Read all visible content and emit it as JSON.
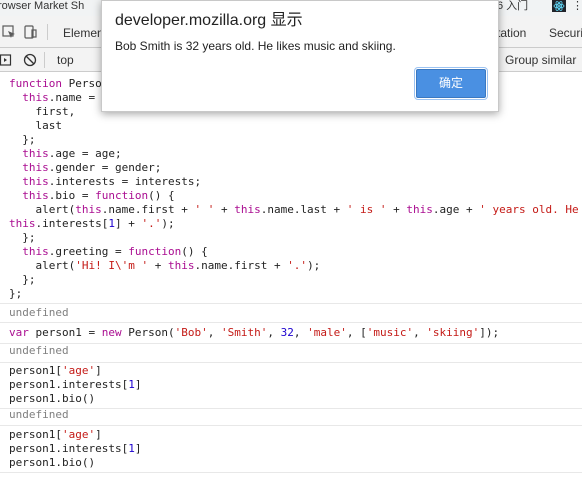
{
  "browser": {
    "tab_title": "rowser Market Sh",
    "right_tab_label": "6 入门",
    "overflow_glyph": "⋮"
  },
  "devtools": {
    "tabs": [
      "Elemen",
      "tation",
      "Securi"
    ]
  },
  "console_toolbar": {
    "context": "top",
    "group_similar": "Group similar"
  },
  "alert": {
    "title": "developer.mozilla.org 显示",
    "message": "Bob Smith is 32 years old. He likes music and skiing.",
    "ok_label": "确定"
  },
  "console": {
    "block1_lines": [
      "function Perso",
      "  this.name = ",
      "    first,",
      "    last",
      "  };",
      "  this.age = age;",
      "  this.gender = gender;",
      "  this.interests = interests;",
      "  this.bio = function() {",
      "    alert(this.name.first + ' ' + this.name.last + ' is ' + this.age + ' years old. He",
      "this.interests[1] + '.');",
      "  };",
      "  this.greeting = function() {",
      "    alert('Hi! I\\'m ' + this.name.first + '.');",
      "  };",
      "};"
    ],
    "result1": "undefined",
    "block2_line": "var person1 = new Person('Bob', 'Smith', 32, 'male', ['music', 'skiing']);",
    "result2": "undefined",
    "block3_lines": [
      "person1['age']",
      "person1.interests[1]",
      "person1.bio()"
    ],
    "result3": "undefined",
    "block4_lines": [
      "person1['age']",
      "person1.interests[1]",
      "person1.bio()"
    ]
  }
}
